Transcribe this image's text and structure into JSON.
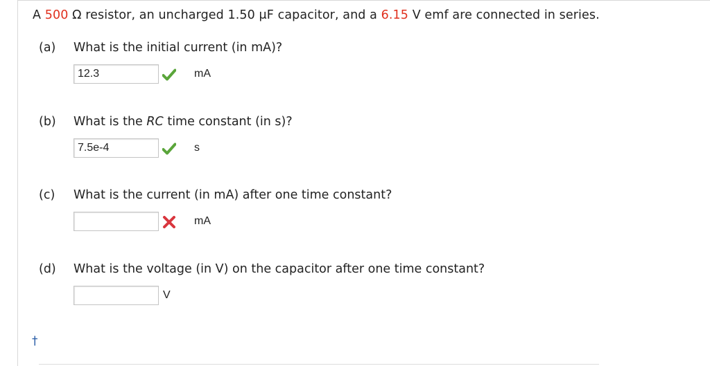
{
  "problem": {
    "prefix": "A ",
    "resistance": "500",
    "part2": " Ω resistor, an uncharged 1.50 μF capacitor, and a ",
    "emf": "6.15",
    "part3": " V emf are connected in series."
  },
  "parts": [
    {
      "letter": "(a)",
      "question_pre": "What is the initial current (in mA)?",
      "answer": "12.3",
      "unit": "mA",
      "status": "correct"
    },
    {
      "letter": "(b)",
      "question_pre": "What is the ",
      "question_italic": "RC",
      "question_post": " time constant (in s)?",
      "answer": "7.5e-4",
      "unit": "s",
      "status": "correct"
    },
    {
      "letter": "(c)",
      "question_pre": "What is the current (in mA) after one time constant?",
      "answer": "",
      "unit": "mA",
      "status": "incorrect"
    },
    {
      "letter": "(d)",
      "question_pre": "What is the voltage (in V) on the capacitor after one time constant?",
      "answer": "",
      "unit": "V",
      "status": "none"
    }
  ],
  "footer": {
    "dagger": "†"
  },
  "colors": {
    "highlight": "#e0301e",
    "correct": "#5aa53a",
    "incorrect": "#d9363e",
    "dagger": "#2b5fa8"
  }
}
